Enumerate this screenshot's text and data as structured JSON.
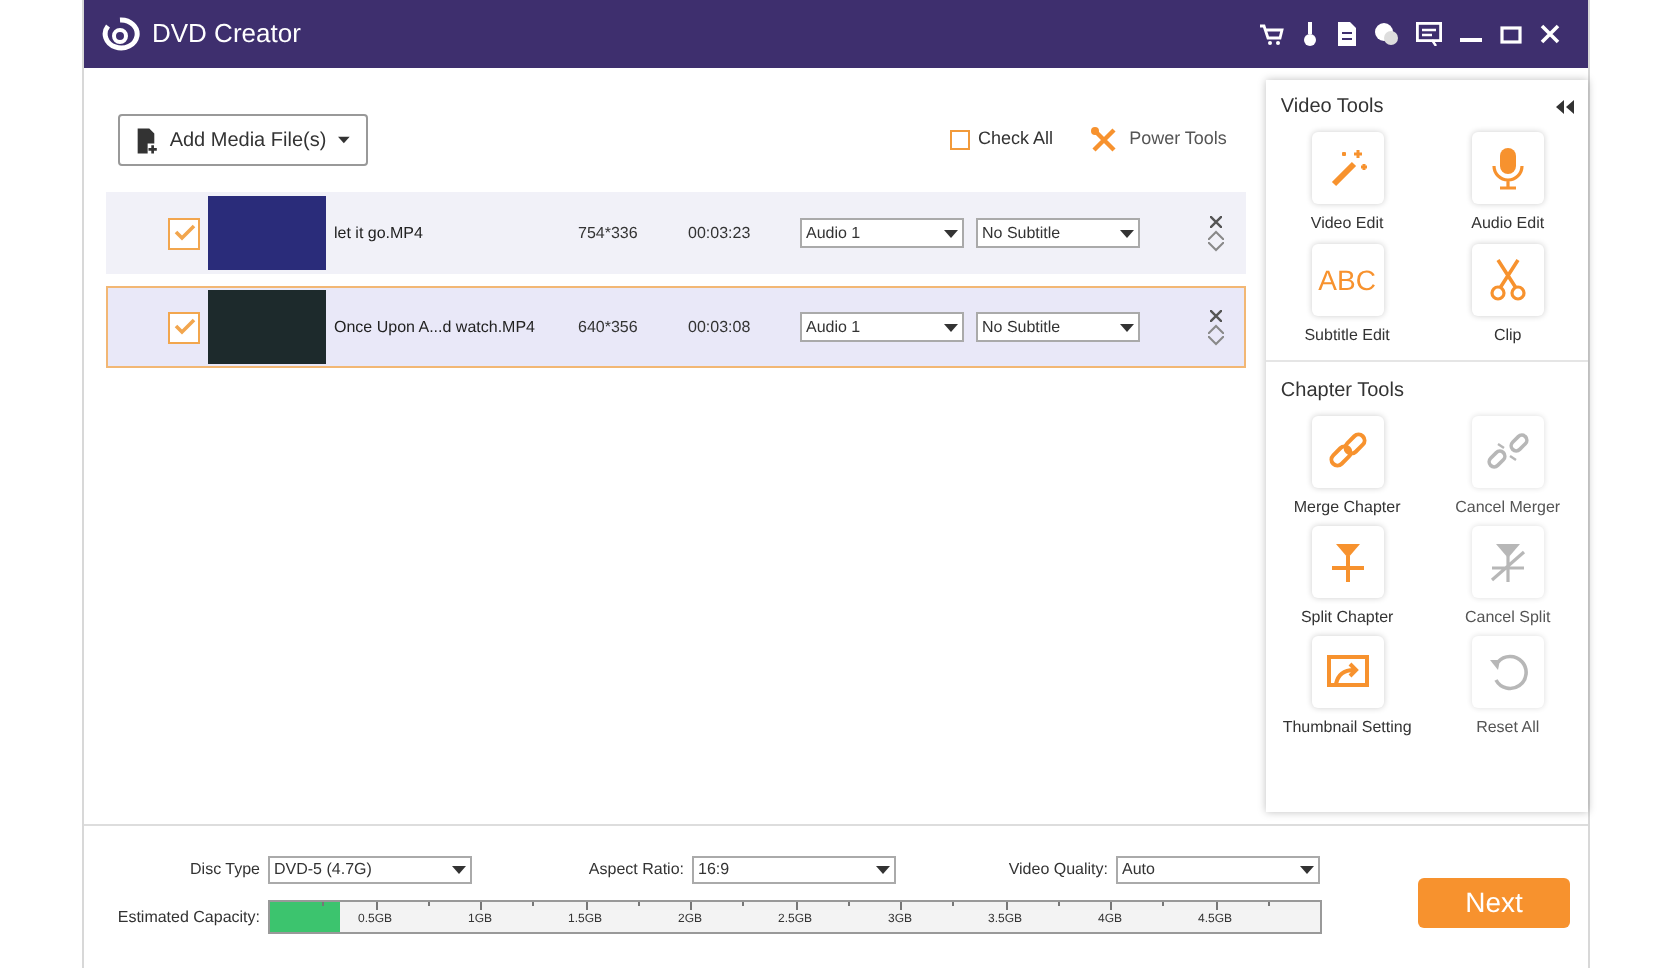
{
  "window": {
    "title": "DVD Creator"
  },
  "toolbar": {
    "add_button": "Add Media File(s)",
    "check_all": {
      "label": "Check All",
      "checked": false
    },
    "power_tools": "Power Tools"
  },
  "files": [
    {
      "name": "let it go.MP4",
      "resolution": "754*336",
      "duration": "00:03:23",
      "audio": "Audio 1",
      "subtitle": "No Subtitle",
      "checked": true,
      "selected": false
    },
    {
      "name": "Once Upon A...d watch.MP4",
      "resolution": "640*356",
      "duration": "00:03:08",
      "audio": "Audio 1",
      "subtitle": "No Subtitle",
      "checked": true,
      "selected": true
    }
  ],
  "video_tools": {
    "title": "Video Tools",
    "items": [
      {
        "label": "Video Edit",
        "kind": "wand",
        "disabled": false
      },
      {
        "label": "Audio Edit",
        "kind": "mic",
        "disabled": false
      },
      {
        "label": "Subtitle Edit",
        "kind": "text",
        "icon_text": "ABC",
        "disabled": false
      },
      {
        "label": "Clip",
        "kind": "scissors",
        "disabled": false
      }
    ]
  },
  "chapter_tools": {
    "title": "Chapter Tools",
    "items": [
      {
        "label": "Merge Chapter",
        "kind": "link",
        "disabled": false
      },
      {
        "label": "Cancel Merger",
        "kind": "unlink",
        "disabled": true
      },
      {
        "label": "Split Chapter",
        "kind": "split",
        "disabled": false
      },
      {
        "label": "Cancel Split",
        "kind": "unsplit",
        "disabled": true
      },
      {
        "label": "Thumbnail Setting",
        "kind": "thumbnail",
        "disabled": false
      },
      {
        "label": "Reset All",
        "kind": "reset",
        "disabled": true
      }
    ]
  },
  "settings": [
    {
      "label": "Disc Type",
      "value": "DVD-5 (4.7G)"
    },
    {
      "label": "Aspect Ratio:",
      "value": "16:9"
    },
    {
      "label": "Video Quality:",
      "value": "Auto"
    }
  ],
  "capacity": {
    "label": "Estimated Capacity:",
    "level": 0.066,
    "ticks": [
      "0.5GB",
      "1GB",
      "1.5GB",
      "2GB",
      "2.5GB",
      "3GB",
      "3.5GB",
      "4GB",
      "4.5GB"
    ]
  },
  "next_button": "Next"
}
